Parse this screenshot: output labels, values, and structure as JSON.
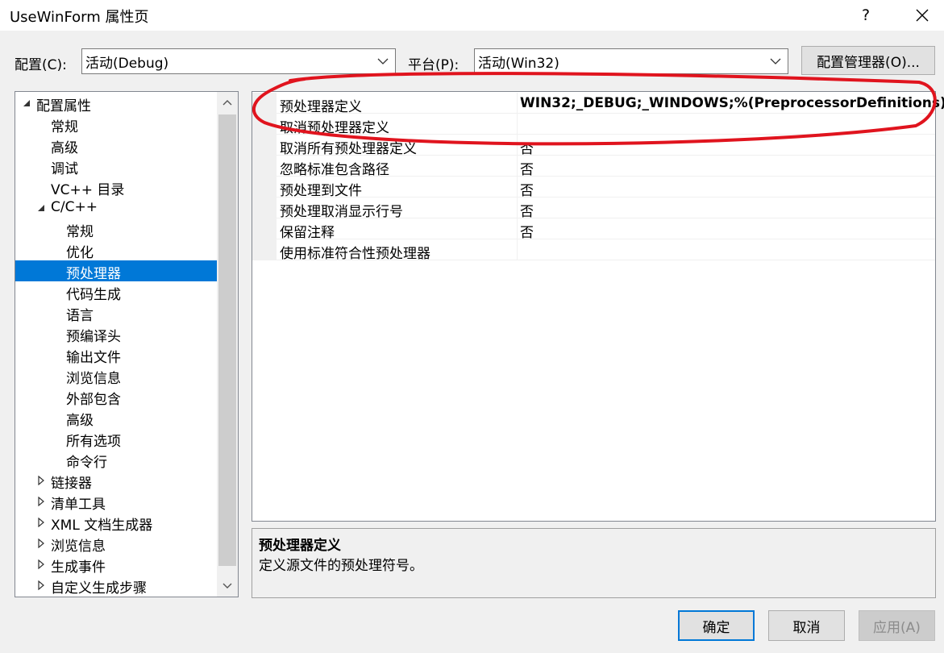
{
  "window": {
    "title": "UseWinForm 属性页",
    "help_label": "?"
  },
  "toolbar": {
    "config_label": "配置(C):",
    "config_value": "活动(Debug)",
    "platform_label": "平台(P):",
    "platform_value": "活动(Win32)",
    "config_manager_label": "配置管理器(O)..."
  },
  "tree": {
    "items": [
      {
        "label": "配置属性",
        "level": 0,
        "state": "expanded"
      },
      {
        "label": "常规",
        "level": 1,
        "state": "leaf"
      },
      {
        "label": "高级",
        "level": 1,
        "state": "leaf"
      },
      {
        "label": "调试",
        "level": 1,
        "state": "leaf"
      },
      {
        "label": "VC++ 目录",
        "level": 1,
        "state": "leaf"
      },
      {
        "label": "C/C++",
        "level": 1,
        "state": "expanded"
      },
      {
        "label": "常规",
        "level": 2,
        "state": "leaf"
      },
      {
        "label": "优化",
        "level": 2,
        "state": "leaf"
      },
      {
        "label": "预处理器",
        "level": 2,
        "state": "leaf",
        "selected": true
      },
      {
        "label": "代码生成",
        "level": 2,
        "state": "leaf"
      },
      {
        "label": "语言",
        "level": 2,
        "state": "leaf"
      },
      {
        "label": "预编译头",
        "level": 2,
        "state": "leaf"
      },
      {
        "label": "输出文件",
        "level": 2,
        "state": "leaf"
      },
      {
        "label": "浏览信息",
        "level": 2,
        "state": "leaf"
      },
      {
        "label": "外部包含",
        "level": 2,
        "state": "leaf"
      },
      {
        "label": "高级",
        "level": 2,
        "state": "leaf"
      },
      {
        "label": "所有选项",
        "level": 2,
        "state": "leaf"
      },
      {
        "label": "命令行",
        "level": 2,
        "state": "leaf"
      },
      {
        "label": "链接器",
        "level": 1,
        "state": "collapsed"
      },
      {
        "label": "清单工具",
        "level": 1,
        "state": "collapsed"
      },
      {
        "label": "XML 文档生成器",
        "level": 1,
        "state": "collapsed"
      },
      {
        "label": "浏览信息",
        "level": 1,
        "state": "collapsed"
      },
      {
        "label": "生成事件",
        "level": 1,
        "state": "collapsed"
      },
      {
        "label": "自定义生成步骤",
        "level": 1,
        "state": "collapsed"
      }
    ]
  },
  "properties": [
    {
      "name": "预处理器定义",
      "value": "WIN32;_DEBUG;_WINDOWS;%(PreprocessorDefinitions)",
      "bold": true
    },
    {
      "name": "取消预处理器定义",
      "value": ""
    },
    {
      "name": "取消所有预处理器定义",
      "value": "否"
    },
    {
      "name": "忽略标准包含路径",
      "value": "否"
    },
    {
      "name": "预处理到文件",
      "value": "否"
    },
    {
      "name": "预处理取消显示行号",
      "value": "否"
    },
    {
      "name": "保留注释",
      "value": "否"
    },
    {
      "name": "使用标准符合性预处理器",
      "value": ""
    }
  ],
  "description": {
    "title": "预处理器定义",
    "text": "定义源文件的预处理符号。"
  },
  "buttons": {
    "ok": "确定",
    "cancel": "取消",
    "apply": "应用(A)"
  },
  "colors": {
    "selection": "#0078d7",
    "annotation": "#e0141e"
  }
}
